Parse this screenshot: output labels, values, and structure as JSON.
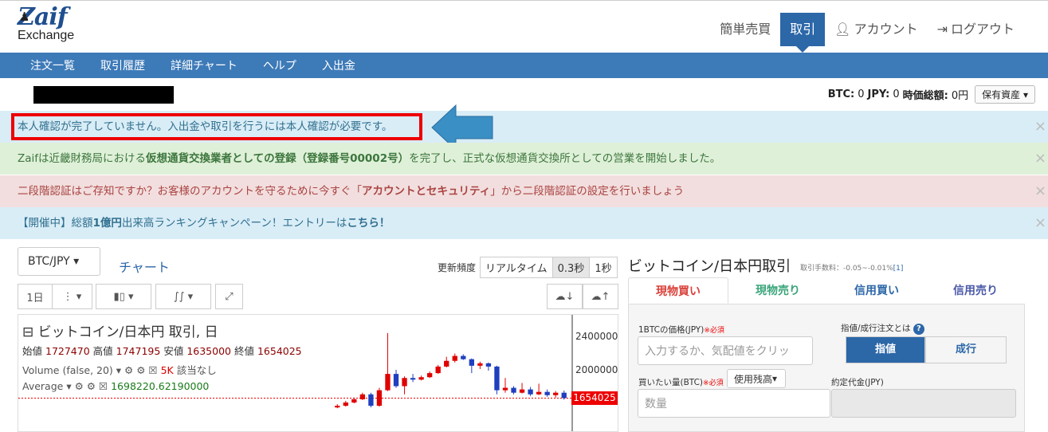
{
  "logo": {
    "main": "Zaif",
    "sub": "Exchange"
  },
  "topnav": {
    "simple": "簡単売買",
    "trade": "取引",
    "account": "アカウント",
    "logout": "ログアウト"
  },
  "menubar": [
    "注文一覧",
    "取引履歴",
    "詳細チャート",
    "ヘルプ",
    "入出金"
  ],
  "balance": {
    "btc_label": "BTC:",
    "btc_value": "0",
    "jpy_label": "JPY:",
    "jpy_value": "0",
    "total_label": "時価総額:",
    "total_value": "0円",
    "assets_button": "保有資産"
  },
  "alerts": {
    "identity": "本人確認が完了していません。入出金や取引を行うには本人確認が必要です。",
    "registration_pre": "Zaifは近畿財務局における",
    "registration_bold": "仮想通貨交換業者としての登録（登録番号00002号）",
    "registration_post": "を完了し、正式な仮想通貨交換所としての営業を開始しました。",
    "twofa_pre": "二段階認証はご存知ですか？お客様のアカウントを守るために今すぐ「",
    "twofa_bold": "アカウントとセキュリティ",
    "twofa_post": "」から二段階認証の設定を行いましょう",
    "campaign_pre": "【開催中】総額",
    "campaign_bold1": "1億円",
    "campaign_mid": "出来高ランキングキャンペーン！エントリーは",
    "campaign_bold2": "こちら！",
    "close": "×"
  },
  "chart_panel": {
    "pair": "BTC/JPY",
    "chart_link": "チャート",
    "freq_label": "更新頻度",
    "freq_options": [
      "リアルタイム",
      "0.3秒",
      "1秒"
    ],
    "interval": "1日",
    "title": "ビットコイン/日本円 取引, 日",
    "ohlc": {
      "open_label": "始値",
      "open": "1727470",
      "high_label": "高値",
      "high": "1747195",
      "low_label": "安値",
      "low": "1635000",
      "close_label": "終値",
      "close": "1654025"
    },
    "volume_label": "Volume (false, 20)",
    "volume_value": "5K",
    "volume_note": "該当なし",
    "average_label": "Average",
    "average_value": "1698220.62190000",
    "price_tag": "1654025",
    "y_ticks": [
      "2400000",
      "2000000"
    ]
  },
  "chart_data": {
    "type": "candlestick",
    "ylim": [
      1500000,
      2500000
    ],
    "candles": [
      {
        "o": 1540000,
        "c": 1560000,
        "h": 1580000,
        "l": 1530000
      },
      {
        "o": 1560000,
        "c": 1600000,
        "h": 1620000,
        "l": 1550000
      },
      {
        "o": 1600000,
        "c": 1640000,
        "h": 1660000,
        "l": 1590000
      },
      {
        "o": 1640000,
        "c": 1700000,
        "h": 1720000,
        "l": 1630000
      },
      {
        "o": 1700000,
        "c": 1560000,
        "h": 1720000,
        "l": 1540000
      },
      {
        "o": 1560000,
        "c": 1750000,
        "h": 1780000,
        "l": 1550000
      },
      {
        "o": 1750000,
        "c": 1950000,
        "h": 2450000,
        "l": 1740000
      },
      {
        "o": 1950000,
        "c": 1800000,
        "h": 2000000,
        "l": 1780000
      },
      {
        "o": 1800000,
        "c": 1900000,
        "h": 1920000,
        "l": 1700000
      },
      {
        "o": 1900000,
        "c": 1880000,
        "h": 1950000,
        "l": 1850000
      },
      {
        "o": 1880000,
        "c": 1910000,
        "h": 1930000,
        "l": 1870000
      },
      {
        "o": 1910000,
        "c": 1960000,
        "h": 1980000,
        "l": 1900000
      },
      {
        "o": 1960000,
        "c": 2040000,
        "h": 2060000,
        "l": 1950000
      },
      {
        "o": 2040000,
        "c": 2110000,
        "h": 2160000,
        "l": 2030000
      },
      {
        "o": 2110000,
        "c": 2170000,
        "h": 2200000,
        "l": 2090000
      },
      {
        "o": 2170000,
        "c": 2130000,
        "h": 2190000,
        "l": 2120000
      },
      {
        "o": 2130000,
        "c": 2050000,
        "h": 2140000,
        "l": 1960000
      },
      {
        "o": 2050000,
        "c": 2080000,
        "h": 2100000,
        "l": 2010000
      },
      {
        "o": 2080000,
        "c": 2040000,
        "h": 2090000,
        "l": 1990000
      },
      {
        "o": 2040000,
        "c": 1750000,
        "h": 2050000,
        "l": 1700000
      },
      {
        "o": 1750000,
        "c": 1780000,
        "h": 1900000,
        "l": 1720000
      },
      {
        "o": 1780000,
        "c": 1720000,
        "h": 1800000,
        "l": 1700000
      },
      {
        "o": 1720000,
        "c": 1760000,
        "h": 1840000,
        "l": 1710000
      },
      {
        "o": 1760000,
        "c": 1700000,
        "h": 1790000,
        "l": 1680000
      },
      {
        "o": 1700000,
        "c": 1730000,
        "h": 1830000,
        "l": 1690000
      },
      {
        "o": 1730000,
        "c": 1690000,
        "h": 1760000,
        "l": 1670000
      },
      {
        "o": 1690000,
        "c": 1720000,
        "h": 1740000,
        "l": 1660000
      },
      {
        "o": 1720000,
        "c": 1654025,
        "h": 1747195,
        "l": 1635000
      }
    ],
    "reference_line": 1654025
  },
  "order_panel": {
    "title": "ビットコイン/日本円取引",
    "fee_label": "取引手数料：-0.05~-0.01%",
    "fee_link": "[1]",
    "tabs": [
      "現物買い",
      "現物売り",
      "信用買い",
      "信用売り"
    ],
    "price_label": "1BTCの価格(JPY)",
    "required": "※必須",
    "price_placeholder": "入力するか、気配値をクリッ",
    "limit_label": "指値/成行注文とは",
    "limit_btn": "指値",
    "market_btn": "成行",
    "amount_label": "買いたい量(BTC)",
    "use_balance_btn": "使用残高",
    "amount_placeholder": "数量",
    "total_label": "約定代金(JPY)"
  },
  "colors": {
    "brand": "#2c67a8",
    "menubar": "#3d7ab8",
    "candle_up": "#e00000",
    "candle_down": "#1f3fbf"
  },
  "icons": [
    "user-icon",
    "logout-icon",
    "close-icon",
    "arrow-icon",
    "help-icon",
    "cloud-download-icon",
    "cloud-upload-icon",
    "candlestick-icon",
    "indicator-icon",
    "fullscreen-icon",
    "menu-dots-icon"
  ]
}
